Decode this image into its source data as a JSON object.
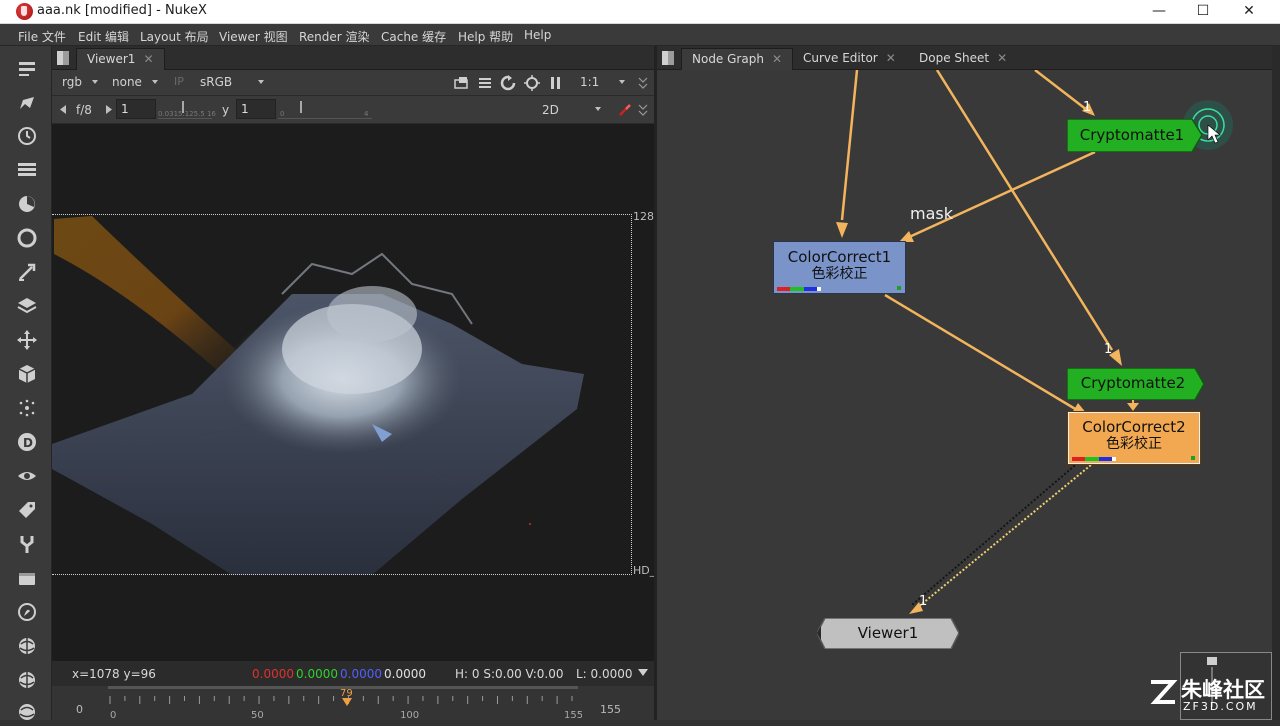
{
  "window": {
    "title": "aaa.nk [modified] - NukeX",
    "controls": {
      "minimize": "—",
      "maximize": "☐",
      "close": "✕"
    }
  },
  "menu": [
    "File 文件",
    "Edit 编辑",
    "Layout 布局",
    "Viewer 视图",
    "Render 渲染",
    "Cache 缓存",
    "Help 帮助",
    "Help"
  ],
  "toolbar": [
    "transform-icon",
    "paint-icon",
    "time-icon",
    "channel-icon",
    "color-icon",
    "filter-icon",
    "keyer-icon",
    "merge-icon",
    "transform-move-icon",
    "3d-icon",
    "particles-icon",
    "deep-icon",
    "views-icon",
    "metadata-icon",
    "tools-icon",
    "toolsets-icon",
    "other-icon",
    "furnace-icon",
    "ocula-icon"
  ],
  "viewer": {
    "tab": "Viewer1",
    "tab_close": "✕",
    "channels": "rgb",
    "mask": "none",
    "ip": "IP",
    "colorspace": "sRGB",
    "zoom": "1:1",
    "fstop": "f/8",
    "gain": "1",
    "gamma_label": "y",
    "gamma": "1",
    "gain_ticks": "0.0315.125.5 16",
    "gamma_ticks_min": "0",
    "gamma_ticks_max": "4",
    "view_mode": "2D",
    "format_top": "128",
    "format_bottom": "HD_"
  },
  "status": {
    "coords": "x=1078 y=96",
    "r": "0.0000",
    "g": "0.0000",
    "b": "0.0000",
    "a": "0.0000",
    "hsv": "H:  0 S:0.00 V:0.00",
    "l": "L: 0.00000"
  },
  "timeline": {
    "start": "0",
    "end": "155",
    "current": "79",
    "ticks": [
      "0",
      "50",
      "100",
      "155"
    ]
  },
  "graph_tabs": [
    {
      "label": "Node Graph",
      "close": "✕"
    },
    {
      "label": "Curve Editor",
      "close": "✕"
    },
    {
      "label": "Dope Sheet",
      "close": "✕"
    }
  ],
  "nodes": {
    "crypto1": "Cryptomatte1",
    "cc1_title": "ColorCorrect1",
    "cc1_sub": "色彩校正",
    "crypto2": "Cryptomatte2",
    "cc2_title": "ColorCorrect2",
    "cc2_sub": "色彩校正",
    "viewer1": "Viewer1"
  },
  "edge_labels": {
    "mask": "mask",
    "in1": "1",
    "in2": "1",
    "viewer_in": "1"
  },
  "watermark": {
    "main": "朱峰社区",
    "sub": "ZF3D.COM"
  },
  "colors": {
    "crypto_node": "#22b022",
    "cc1_node": "#7a93c8",
    "cc2_node": "#f2a850",
    "edge": "#f2b45c",
    "viewer_node": "#bdbdbd"
  }
}
